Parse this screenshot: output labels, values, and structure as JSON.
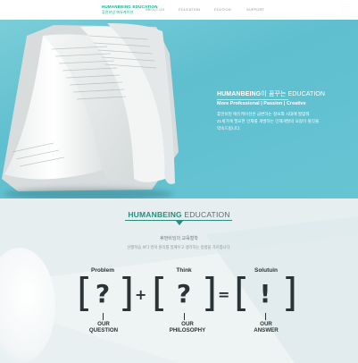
{
  "header": {
    "logo_line1": "HUMANBEING EDUCATION",
    "logo_line2": "휴먼비잉 에듀케이션",
    "nav": [
      "ABOUT US",
      "EDUCATION",
      "EDUTION",
      "SUPPORT"
    ],
    "menu_icon": "hamburger-icon"
  },
  "hero": {
    "title_brand": "HUMANBEING",
    "title_rest": "이 꿈꾸는 EDUCATION",
    "subtitle": "More Professional | Passion | Creative",
    "desc_lines": [
      "휴먼비잉 에듀케이션은 급변하는 정보화 시대에 발맞춰",
      "21세기에 필요한 인재를 개발하는 인재개발의 요람이 될것을",
      "약속드립니다."
    ]
  },
  "education": {
    "title_brand": "HUMANBEING",
    "title_rest": " EDUCATION",
    "subtitle": "휴먼비잉의 교육철학",
    "description": "선행학습 보다 먼저 원리를 일깨우고 생각하는 방법을 가르칩니다.",
    "labels": [
      "Problem",
      "Think",
      "Solutuin"
    ],
    "symbols": [
      "?",
      "?",
      "!"
    ],
    "operators": [
      "+",
      "="
    ],
    "captions": [
      [
        "OUR",
        "QUESTION"
      ],
      [
        "OUR",
        "PHILOSOPHY"
      ],
      [
        "OUR",
        "ANSWER"
      ]
    ]
  },
  "colors": {
    "hero_bg": "#6ec9d6",
    "accent": "#2a8c7c",
    "section_bg": "#eef3f4"
  }
}
